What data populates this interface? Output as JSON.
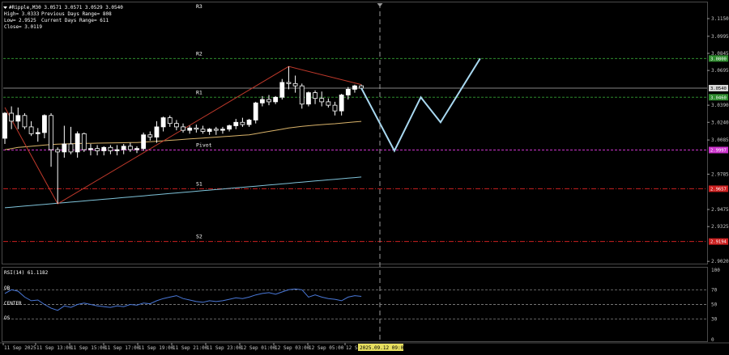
{
  "header": {
    "symbol_line": "#Ripple,M30  3.0571 3.0571 3.0529 3.0540",
    "high_line": "High= 3.0333",
    "low_line": "Low= 2.9525",
    "close_line": "Close= 3.0119",
    "prev_range": "Previous Days Range= 808",
    "curr_range": "Current Days Range= 611"
  },
  "rsi_label": "RSI(14) 61.1182",
  "rsi_levels": {
    "ob": "OB",
    "center": "CENTER",
    "os": "OS"
  },
  "current_time_label": "2025.09.12 09:00",
  "colors": {
    "background": "#000000",
    "bull_candle": "#ffffff",
    "bear_candle": "#000000",
    "ma_slow": "#7fc3d9",
    "ma_fast": "#d9b36a",
    "zigzag": "#c0392b",
    "projection": "#a8d8f0",
    "r_level": "#2e8b2e",
    "s_level": "#cc2020",
    "pivot_level": "#cc33cc",
    "rsi_line": "#4a78d8",
    "price_line": "#b0b0b0"
  },
  "chart_data": {
    "type": "candlestick",
    "symbol": "#Ripple",
    "timeframe": "M30",
    "ylim": [
      2.9,
      3.1285
    ],
    "y_ticks": [
      "3.1150",
      "3.0995",
      "3.0845",
      "3.0695",
      "3.0390",
      "3.0240",
      "3.0085",
      "2.9785",
      "2.9475",
      "2.9325",
      "2.9020"
    ],
    "x_ticks": [
      "11 Sep 2025",
      "11 Sep 13:00",
      "11 Sep 15:00",
      "11 Sep 17:00",
      "11 Sep 19:00",
      "11 Sep 21:00",
      "11 Sep 23:00",
      "12 Sep 01:00",
      "12 Sep 03:00",
      "12 Sep 05:00",
      "12 Se"
    ],
    "candles": [
      {
        "o": 3.01,
        "h": 3.033,
        "l": 3.005,
        "c": 3.032
      },
      {
        "o": 3.032,
        "h": 3.038,
        "l": 3.018,
        "c": 3.025
      },
      {
        "o": 3.025,
        "h": 3.037,
        "l": 3.018,
        "c": 3.03
      },
      {
        "o": 3.03,
        "h": 3.032,
        "l": 3.018,
        "c": 3.02
      },
      {
        "o": 3.02,
        "h": 3.025,
        "l": 3.012,
        "c": 3.014
      },
      {
        "o": 3.014,
        "h": 3.019,
        "l": 3.007,
        "c": 3.015
      },
      {
        "o": 3.015,
        "h": 3.031,
        "l": 3.01,
        "c": 3.03
      },
      {
        "o": 3.03,
        "h": 3.032,
        "l": 2.985,
        "c": 3.0
      },
      {
        "o": 3.0,
        "h": 3.002,
        "l": 2.9525,
        "c": 2.998
      },
      {
        "o": 2.998,
        "h": 3.021,
        "l": 2.993,
        "c": 3.005
      },
      {
        "o": 3.005,
        "h": 3.02,
        "l": 2.996,
        "c": 2.998
      },
      {
        "o": 2.998,
        "h": 3.016,
        "l": 2.993,
        "c": 3.014
      },
      {
        "o": 3.014,
        "h": 3.015,
        "l": 2.998,
        "c": 3.0
      },
      {
        "o": 3.0,
        "h": 3.005,
        "l": 2.995,
        "c": 3.001
      },
      {
        "o": 3.001,
        "h": 3.004,
        "l": 2.995,
        "c": 2.999
      },
      {
        "o": 2.999,
        "h": 3.003,
        "l": 2.995,
        "c": 3.002
      },
      {
        "o": 3.002,
        "h": 3.004,
        "l": 2.996,
        "c": 2.999
      },
      {
        "o": 2.999,
        "h": 3.004,
        "l": 2.995,
        "c": 3.0
      },
      {
        "o": 3.0,
        "h": 3.005,
        "l": 2.996,
        "c": 3.003
      },
      {
        "o": 3.003,
        "h": 3.006,
        "l": 2.998,
        "c": 3.0
      },
      {
        "o": 3.0,
        "h": 3.003,
        "l": 2.997,
        "c": 3.001
      },
      {
        "o": 3.001,
        "h": 3.015,
        "l": 2.999,
        "c": 3.013
      },
      {
        "o": 3.013,
        "h": 3.016,
        "l": 3.008,
        "c": 3.011
      },
      {
        "o": 3.011,
        "h": 3.025,
        "l": 3.006,
        "c": 3.02
      },
      {
        "o": 3.02,
        "h": 3.029,
        "l": 3.016,
        "c": 3.028
      },
      {
        "o": 3.028,
        "h": 3.03,
        "l": 3.02,
        "c": 3.023
      },
      {
        "o": 3.023,
        "h": 3.026,
        "l": 3.017,
        "c": 3.02
      },
      {
        "o": 3.02,
        "h": 3.023,
        "l": 3.015,
        "c": 3.017
      },
      {
        "o": 3.017,
        "h": 3.021,
        "l": 3.014,
        "c": 3.019
      },
      {
        "o": 3.019,
        "h": 3.022,
        "l": 3.015,
        "c": 3.018
      },
      {
        "o": 3.018,
        "h": 3.021,
        "l": 3.014,
        "c": 3.016
      },
      {
        "o": 3.016,
        "h": 3.019,
        "l": 3.013,
        "c": 3.018
      },
      {
        "o": 3.018,
        "h": 3.02,
        "l": 3.013,
        "c": 3.017
      },
      {
        "o": 3.017,
        "h": 3.02,
        "l": 3.014,
        "c": 3.018
      },
      {
        "o": 3.018,
        "h": 3.022,
        "l": 3.016,
        "c": 3.021
      },
      {
        "o": 3.021,
        "h": 3.027,
        "l": 3.018,
        "c": 3.024
      },
      {
        "o": 3.024,
        "h": 3.028,
        "l": 3.02,
        "c": 3.022
      },
      {
        "o": 3.022,
        "h": 3.027,
        "l": 3.02,
        "c": 3.026
      },
      {
        "o": 3.026,
        "h": 3.042,
        "l": 3.023,
        "c": 3.041
      },
      {
        "o": 3.041,
        "h": 3.047,
        "l": 3.038,
        "c": 3.044
      },
      {
        "o": 3.044,
        "h": 3.048,
        "l": 3.039,
        "c": 3.042
      },
      {
        "o": 3.042,
        "h": 3.047,
        "l": 3.04,
        "c": 3.046
      },
      {
        "o": 3.046,
        "h": 3.062,
        "l": 3.044,
        "c": 3.059
      },
      {
        "o": 3.059,
        "h": 3.073,
        "l": 3.053,
        "c": 3.058
      },
      {
        "o": 3.058,
        "h": 3.065,
        "l": 3.05,
        "c": 3.056
      },
      {
        "o": 3.056,
        "h": 3.058,
        "l": 3.036,
        "c": 3.04
      },
      {
        "o": 3.04,
        "h": 3.051,
        "l": 3.038,
        "c": 3.05
      },
      {
        "o": 3.05,
        "h": 3.052,
        "l": 3.04,
        "c": 3.045
      },
      {
        "o": 3.045,
        "h": 3.051,
        "l": 3.038,
        "c": 3.042
      },
      {
        "o": 3.042,
        "h": 3.045,
        "l": 3.037,
        "c": 3.039
      },
      {
        "o": 3.039,
        "h": 3.042,
        "l": 3.03,
        "c": 3.034
      },
      {
        "o": 3.034,
        "h": 3.049,
        "l": 3.03,
        "c": 3.048
      },
      {
        "o": 3.048,
        "h": 3.055,
        "l": 3.044,
        "c": 3.053
      },
      {
        "o": 3.053,
        "h": 3.057,
        "l": 3.05,
        "c": 3.056
      },
      {
        "o": 3.056,
        "h": 3.0571,
        "l": 3.0529,
        "c": 3.054
      }
    ],
    "ma_fast": [
      3.0,
      3.001,
      3.002,
      3.0025,
      3.003,
      3.0035,
      3.004,
      3.0045,
      3.0048,
      3.005,
      3.0052,
      3.0054,
      3.0055,
      3.0056,
      3.0057,
      3.0058,
      3.0059,
      3.006,
      3.0061,
      3.0062,
      3.0063,
      3.0066,
      3.007,
      3.0074,
      3.0078,
      3.0082,
      3.0086,
      3.009,
      3.0094,
      3.0098,
      3.0102,
      3.0106,
      3.011,
      3.0114,
      3.0118,
      3.0122,
      3.0126,
      3.013,
      3.014,
      3.015,
      3.016,
      3.017,
      3.018,
      3.019,
      3.0198,
      3.0204,
      3.021,
      3.0215,
      3.022,
      3.0224,
      3.0228,
      3.0233,
      3.0238,
      3.0243,
      3.0248
    ],
    "ma_slow": [
      2.949,
      2.9495,
      2.95,
      2.9505,
      2.951,
      2.9515,
      2.952,
      2.9525,
      2.953,
      2.9535,
      2.954,
      2.9545,
      2.955,
      2.9555,
      2.956,
      2.9565,
      2.957,
      2.9575,
      2.958,
      2.9585,
      2.959,
      2.9595,
      2.96,
      2.9605,
      2.961,
      2.9615,
      2.962,
      2.9625,
      2.963,
      2.9635,
      2.964,
      2.9645,
      2.965,
      2.9655,
      2.966,
      2.9665,
      2.967,
      2.9675,
      2.968,
      2.9685,
      2.969,
      2.9695,
      2.97,
      2.9705,
      2.971,
      2.9715,
      2.972,
      2.9725,
      2.973,
      2.9735,
      2.974,
      2.9745,
      2.975,
      2.9755,
      2.976
    ],
    "zigzag": [
      {
        "i": 0,
        "p": 3.037
      },
      {
        "i": 8,
        "p": 2.9525
      },
      {
        "i": 43,
        "p": 3.073
      },
      {
        "i": 54,
        "p": 3.0571
      }
    ],
    "projection": [
      {
        "i": 54,
        "p": 3.054
      },
      {
        "i": 59,
        "p": 2.999
      },
      {
        "i": 63,
        "p": 3.046
      },
      {
        "i": 66,
        "p": 3.024
      },
      {
        "i": 72,
        "p": 3.08
      }
    ],
    "levels": [
      {
        "name": "R3",
        "price": null,
        "box": ""
      },
      {
        "name": "R2",
        "price": 3.08,
        "box": "3.0800"
      },
      {
        "name": "R1",
        "price": 3.046,
        "box": "3.0460"
      },
      {
        "name": "Pivot",
        "price": 2.9997,
        "box": "2.9997"
      },
      {
        "name": "S1",
        "price": 2.9657,
        "box": "2.9657"
      },
      {
        "name": "S2",
        "price": 2.9194,
        "box": "2.9194"
      }
    ],
    "current_price": {
      "price": 3.054,
      "box": "3.0540"
    },
    "rsi": {
      "label": "RSI(14)",
      "value": 61.1182,
      "ylim": [
        0,
        100
      ],
      "ticks": [
        "100",
        "70",
        "50",
        "30",
        "0"
      ],
      "levels": [
        70,
        50,
        30
      ],
      "values": [
        65,
        70,
        68,
        60,
        55,
        56,
        50,
        45,
        42,
        48,
        46,
        50,
        52,
        50,
        48,
        47,
        46,
        48,
        47,
        50,
        49,
        52,
        51,
        55,
        58,
        60,
        62,
        58,
        56,
        54,
        53,
        55,
        54,
        55,
        57,
        59,
        58,
        60,
        63,
        65,
        66,
        64,
        67,
        70,
        71,
        70,
        60,
        63,
        60,
        58,
        57,
        55,
        60,
        62,
        61
      ]
    }
  }
}
